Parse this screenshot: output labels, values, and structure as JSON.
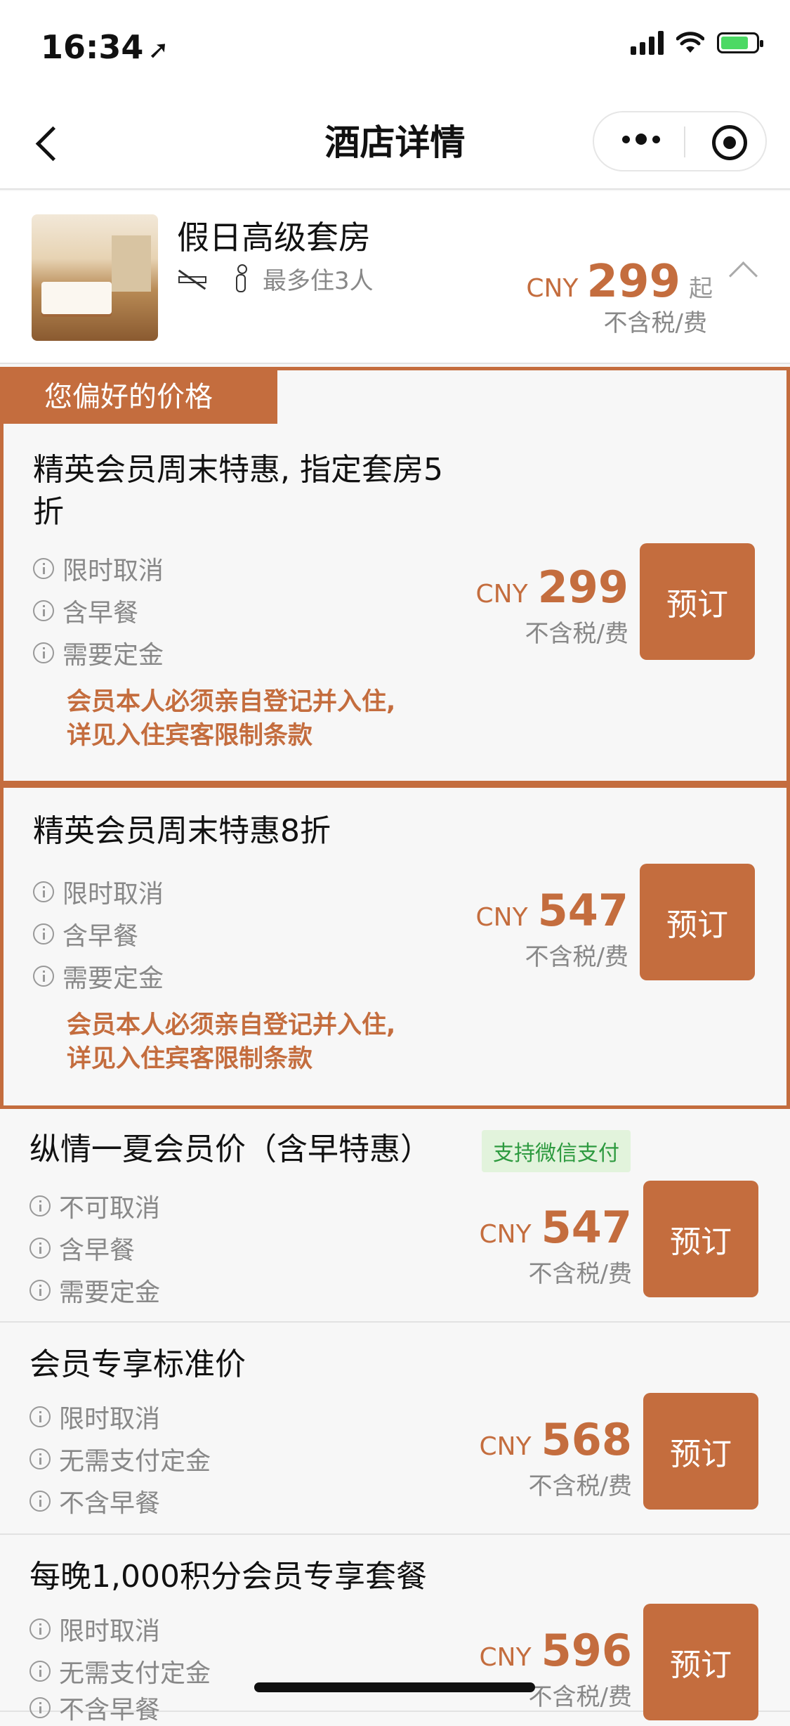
{
  "status": {
    "time": "16:34"
  },
  "nav": {
    "title": "酒店详情"
  },
  "room": {
    "name": "假日高级套房",
    "max_occupancy": "最多住3人",
    "currency": "CNY",
    "price": "299",
    "from": "起",
    "tax_note": "不含税/费"
  },
  "preferred_label": "您偏好的价格",
  "rates": [
    {
      "title_line1": "精英会员周末特惠, 指定套房5",
      "title_line2": "折",
      "conditions": [
        "限时取消",
        "含早餐",
        "需要定金"
      ],
      "notice_line1": "会员本人必须亲自登记并入住,",
      "notice_line2": "详见入住宾客限制条款",
      "currency": "CNY",
      "price": "299",
      "tax_note": "不含税/费",
      "book": "预订"
    },
    {
      "title_line1": "精英会员周末特惠8折",
      "conditions": [
        "限时取消",
        "含早餐",
        "需要定金"
      ],
      "notice_line1": "会员本人必须亲自登记并入住,",
      "notice_line2": "详见入住宾客限制条款",
      "currency": "CNY",
      "price": "547",
      "tax_note": "不含税/费",
      "book": "预订"
    },
    {
      "title_line1": "纵情一夏会员价（含早特惠）",
      "badge": "支持微信支付",
      "conditions": [
        "不可取消",
        "含早餐",
        "需要定金"
      ],
      "currency": "CNY",
      "price": "547",
      "tax_note": "不含税/费",
      "book": "预订"
    },
    {
      "title_line1": "会员专享标准价",
      "conditions": [
        "限时取消",
        "无需支付定金",
        "不含早餐"
      ],
      "currency": "CNY",
      "price": "568",
      "tax_note": "不含税/费",
      "book": "预订"
    },
    {
      "title_line1": "每晚1,000积分会员专享套餐",
      "conditions": [
        "限时取消",
        "无需支付定金",
        "不含早餐"
      ],
      "currency": "CNY",
      "price": "596",
      "tax_note": "不含税/费",
      "book": "预订"
    }
  ],
  "colors": {
    "accent": "#c46d3e",
    "wechat_green": "#2d9a3f",
    "background": "#f7f7f7"
  }
}
